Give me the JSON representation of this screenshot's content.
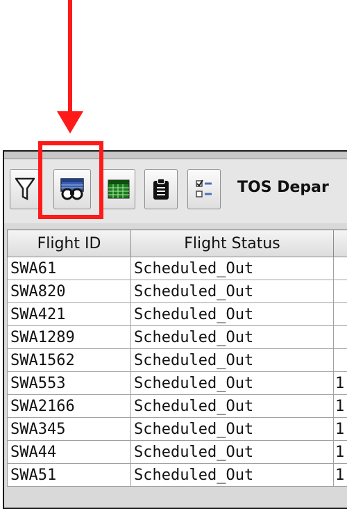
{
  "colors": {
    "annotation": "#ff1a1a"
  },
  "annotation": {
    "arrow_icon": "down-arrow-icon",
    "highlight_target": "binoculars-button"
  },
  "toolbar": {
    "title": "TOS Depar",
    "buttons": [
      {
        "icon": "filter-icon"
      },
      {
        "icon": "binoculars-icon"
      },
      {
        "icon": "table-grid-icon"
      },
      {
        "icon": "clipboard-icon"
      },
      {
        "icon": "checklist-icon"
      }
    ]
  },
  "table": {
    "columns": [
      "Flight ID",
      "Flight Status",
      ""
    ],
    "rows": [
      {
        "flight_id": "SWA61",
        "status": "Scheduled_Out",
        "extra": ""
      },
      {
        "flight_id": "SWA820",
        "status": "Scheduled_Out",
        "extra": ""
      },
      {
        "flight_id": "SWA421",
        "status": "Scheduled_Out",
        "extra": ""
      },
      {
        "flight_id": "SWA1289",
        "status": "Scheduled_Out",
        "extra": ""
      },
      {
        "flight_id": "SWA1562",
        "status": "Scheduled_Out",
        "extra": ""
      },
      {
        "flight_id": "SWA553",
        "status": "Scheduled_Out",
        "extra": "1"
      },
      {
        "flight_id": "SWA2166",
        "status": "Scheduled_Out",
        "extra": "1"
      },
      {
        "flight_id": "SWA345",
        "status": "Scheduled_Out",
        "extra": "1"
      },
      {
        "flight_id": "SWA44",
        "status": "Scheduled_Out",
        "extra": "1"
      },
      {
        "flight_id": "SWA51",
        "status": "Scheduled_Out",
        "extra": "1"
      }
    ]
  }
}
